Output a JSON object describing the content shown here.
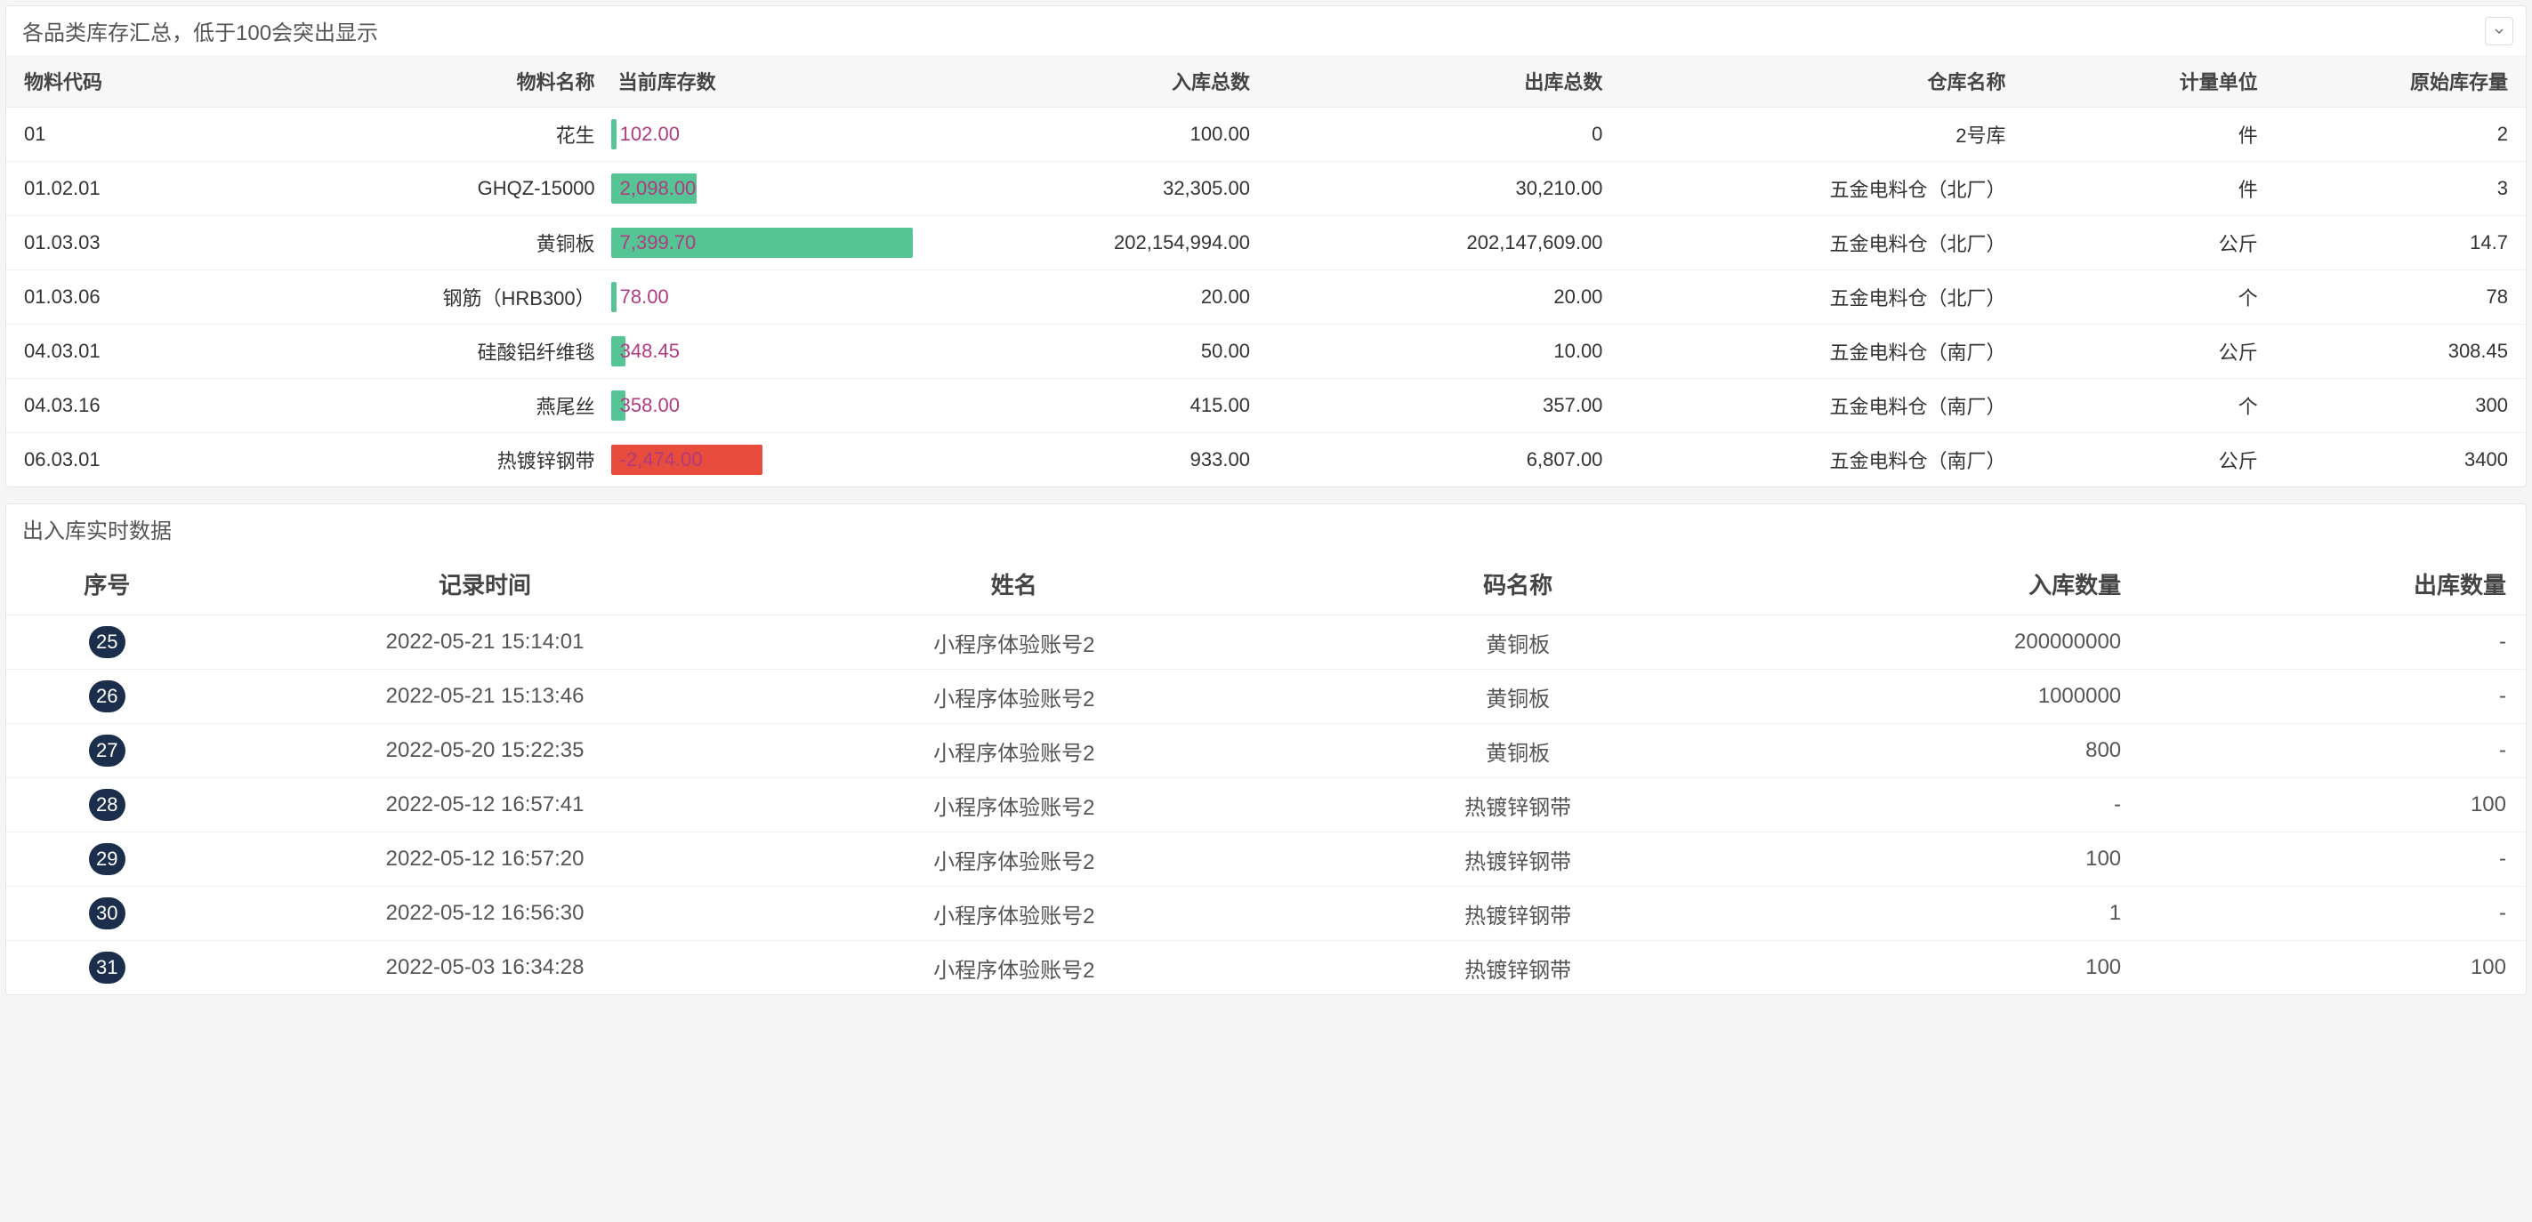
{
  "panel1": {
    "title": "各品类库存汇总，低于100会突出显示",
    "columns": [
      "物料代码",
      "物料名称",
      "当前库存数",
      "入库总数",
      "出库总数",
      "仓库名称",
      "计量单位",
      "原始库存量"
    ],
    "bar_max": 7399.7,
    "rows": [
      {
        "code": "01",
        "name": "花生",
        "stock_disp": "102.00",
        "stock_val": 102.0,
        "in": "100.00",
        "out": "0",
        "warehouse": "2号库",
        "unit": "件",
        "initial": "2"
      },
      {
        "code": "01.02.01",
        "name": "GHQZ-15000",
        "stock_disp": "2,098.00",
        "stock_val": 2098.0,
        "in": "32,305.00",
        "out": "30,210.00",
        "warehouse": "五金电料仓（北厂）",
        "unit": "件",
        "initial": "3"
      },
      {
        "code": "01.03.03",
        "name": "黄铜板",
        "stock_disp": "7,399.70",
        "stock_val": 7399.7,
        "in": "202,154,994.00",
        "out": "202,147,609.00",
        "warehouse": "五金电料仓（北厂）",
        "unit": "公斤",
        "initial": "14.7"
      },
      {
        "code": "01.03.06",
        "name": "钢筋（HRB300）",
        "stock_disp": "78.00",
        "stock_val": 78.0,
        "in": "20.00",
        "out": "20.00",
        "warehouse": "五金电料仓（北厂）",
        "unit": "个",
        "initial": "78"
      },
      {
        "code": "04.03.01",
        "name": "硅酸铝纤维毯",
        "stock_disp": "348.45",
        "stock_val": 348.45,
        "in": "50.00",
        "out": "10.00",
        "warehouse": "五金电料仓（南厂）",
        "unit": "公斤",
        "initial": "308.45"
      },
      {
        "code": "04.03.16",
        "name": "燕尾丝",
        "stock_disp": "358.00",
        "stock_val": 358.0,
        "in": "415.00",
        "out": "357.00",
        "warehouse": "五金电料仓（南厂）",
        "unit": "个",
        "initial": "300"
      },
      {
        "code": "06.03.01",
        "name": "热镀锌钢带",
        "stock_disp": "-2,474.00",
        "stock_val": -2474.0,
        "in": "933.00",
        "out": "6,807.00",
        "warehouse": "五金电料仓（南厂）",
        "unit": "公斤",
        "initial": "3400"
      }
    ]
  },
  "panel2": {
    "title": "出入库实时数据",
    "columns": [
      "序号",
      "记录时间",
      "姓名",
      "码名称",
      "入库数量",
      "出库数量"
    ],
    "rows": [
      {
        "no": "25",
        "time": "2022-05-21 15:14:01",
        "user": "小程序体验账号2",
        "item": "黄铜板",
        "in": "200000000",
        "out": "-"
      },
      {
        "no": "26",
        "time": "2022-05-21 15:13:46",
        "user": "小程序体验账号2",
        "item": "黄铜板",
        "in": "1000000",
        "out": "-"
      },
      {
        "no": "27",
        "time": "2022-05-20 15:22:35",
        "user": "小程序体验账号2",
        "item": "黄铜板",
        "in": "800",
        "out": "-"
      },
      {
        "no": "28",
        "time": "2022-05-12 16:57:41",
        "user": "小程序体验账号2",
        "item": "热镀锌钢带",
        "in": "-",
        "out": "100"
      },
      {
        "no": "29",
        "time": "2022-05-12 16:57:20",
        "user": "小程序体验账号2",
        "item": "热镀锌钢带",
        "in": "100",
        "out": "-"
      },
      {
        "no": "30",
        "time": "2022-05-12 16:56:30",
        "user": "小程序体验账号2",
        "item": "热镀锌钢带",
        "in": "1",
        "out": "-"
      },
      {
        "no": "31",
        "time": "2022-05-03 16:34:28",
        "user": "小程序体验账号2",
        "item": "热镀锌钢带",
        "in": "100",
        "out": "100"
      }
    ]
  },
  "chart_data": {
    "type": "bar",
    "title": "当前库存数",
    "categories": [
      "01",
      "01.02.01",
      "01.03.03",
      "01.03.06",
      "04.03.01",
      "04.03.16",
      "06.03.01"
    ],
    "values": [
      102.0,
      2098.0,
      7399.7,
      78.0,
      348.45,
      358.0,
      -2474.0
    ],
    "xlabel": "物料代码",
    "ylabel": "当前库存数",
    "ylim": [
      -2474,
      7399.7
    ]
  }
}
